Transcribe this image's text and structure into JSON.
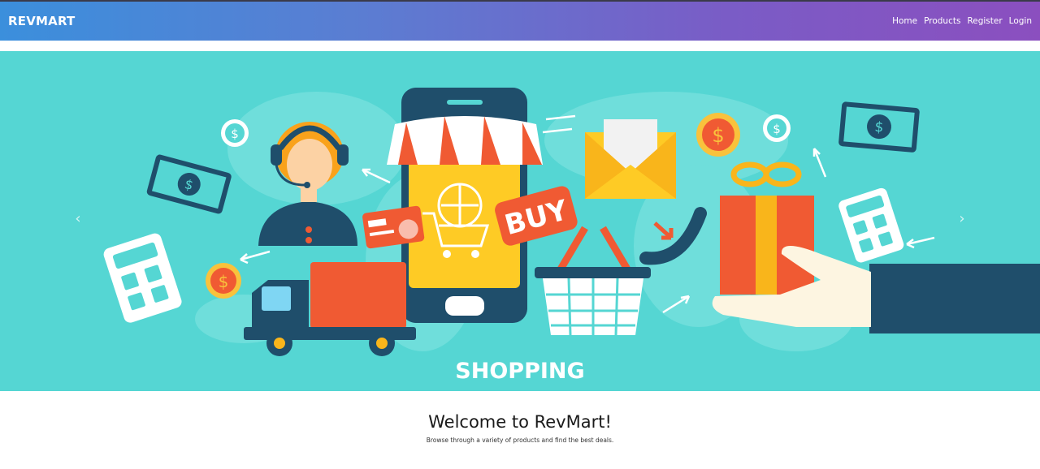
{
  "navbar": {
    "brand": "REVMART",
    "links": [
      "Home",
      "Products",
      "Register",
      "Login"
    ]
  },
  "hero": {
    "banner_text": "SHOPPING",
    "buy_label": "BUY",
    "background_color": "#55d6d3",
    "icons": {
      "prev": "chevron-left-icon",
      "next": "chevron-right-icon"
    }
  },
  "welcome": {
    "title": "Welcome to RevMart!",
    "subtitle": "Browse through a variety of products and find the best deals."
  }
}
